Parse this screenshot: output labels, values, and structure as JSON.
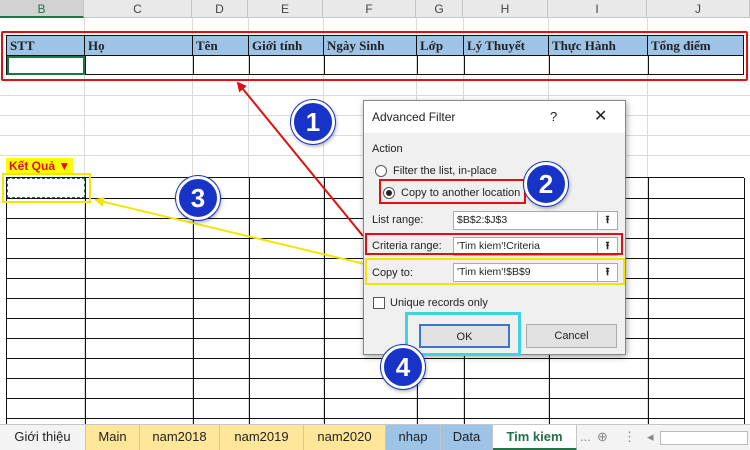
{
  "columns": [
    "B",
    "C",
    "D",
    "E",
    "F",
    "G",
    "H",
    "I",
    "J"
  ],
  "criteria_headers": [
    "STT",
    "Họ",
    "Tên",
    "Giới tính",
    "Ngày Sinh",
    "Lớp",
    "Lý Thuyết",
    "Thực Hành",
    "Tổng điểm"
  ],
  "result_label": "Kết Quả ▼",
  "dialog": {
    "title": "Advanced Filter",
    "help": "?",
    "close": "✕",
    "action_label": "Action",
    "radio1": "Filter the list, in-place",
    "radio2": "Copy to another location",
    "list_range_label": "List range:",
    "list_range_value": "$B$2:$J$3",
    "criteria_range_label": "Criteria range:",
    "criteria_range_value": "'Tim kiem'!Criteria",
    "copy_to_label": "Copy to:",
    "copy_to_value": "'Tim kiem'!$B$9",
    "unique_label": "Unique records only",
    "ok": "OK",
    "cancel": "Cancel"
  },
  "badges": [
    "1",
    "2",
    "3",
    "4"
  ],
  "tabs": [
    "Giới thiệu",
    "Main",
    "nam2018",
    "nam2019",
    "nam2020",
    "nhap",
    "Data",
    "Tim kiem"
  ],
  "tab_more": "...",
  "colors": {
    "red": "#e01010",
    "yellow": "#f2e600",
    "cyan": "#3dd6e0",
    "badge": "#1833c8",
    "header_blue": "#9dc3e6",
    "excel_green": "#217346"
  }
}
